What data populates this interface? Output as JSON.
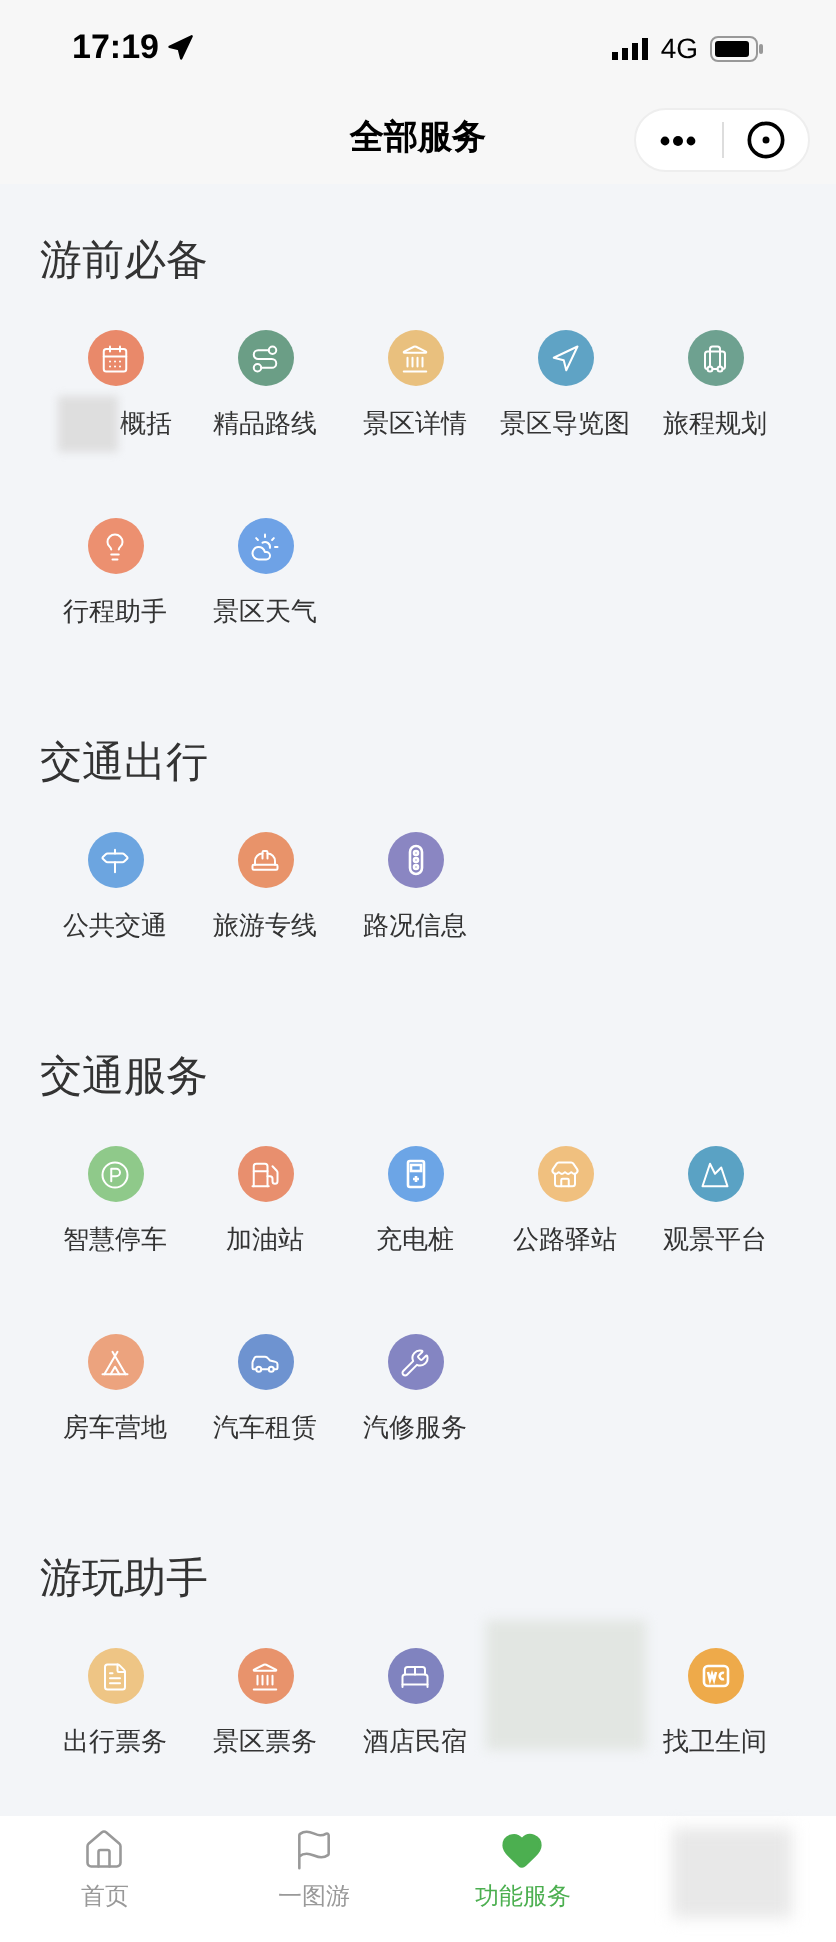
{
  "status_bar": {
    "time": "17:19",
    "network": "4G"
  },
  "nav": {
    "title": "全部服务"
  },
  "sections": [
    {
      "title": "游前必备",
      "items": [
        {
          "kind": "masked_label",
          "label": "概括",
          "color": "#e9896a"
        },
        {
          "kind": "service",
          "label": "精品路线",
          "color": "#6b9e86"
        },
        {
          "kind": "service",
          "label": "景区详情",
          "color": "#e9c07e"
        },
        {
          "kind": "service",
          "label": "景区导览图",
          "color": "#5fa3c5"
        },
        {
          "kind": "service",
          "label": "旅程规划",
          "color": "#6ea190"
        },
        {
          "kind": "service",
          "label": "行程助手",
          "color": "#ec9070"
        },
        {
          "kind": "service",
          "label": "景区天气",
          "color": "#6ea2e6"
        }
      ]
    },
    {
      "title": "交通出行",
      "items": [
        {
          "kind": "service",
          "label": "公共交通",
          "color": "#6ca5e0"
        },
        {
          "kind": "service",
          "label": "旅游专线",
          "color": "#e8936a"
        },
        {
          "kind": "service",
          "label": "路况信息",
          "color": "#8a86c2"
        }
      ]
    },
    {
      "title": "交通服务",
      "items": [
        {
          "kind": "service",
          "label": "智慧停车",
          "color": "#8fc98a"
        },
        {
          "kind": "service",
          "label": "加油站",
          "color": "#e88f6e"
        },
        {
          "kind": "service",
          "label": "充电桩",
          "color": "#6ca5e6"
        },
        {
          "kind": "service",
          "label": "公路驿站",
          "color": "#f0c07f"
        },
        {
          "kind": "service",
          "label": "观景平台",
          "color": "#5aa2c4"
        },
        {
          "kind": "service",
          "label": "房车营地",
          "color": "#eca37e"
        },
        {
          "kind": "service",
          "label": "汽车租赁",
          "color": "#6e93d0"
        },
        {
          "kind": "service",
          "label": "汽修服务",
          "color": "#8485c2"
        }
      ]
    },
    {
      "title": "游玩助手",
      "items": [
        {
          "kind": "service",
          "label": "出行票务",
          "color": "#eec585"
        },
        {
          "kind": "service",
          "label": "景区票务",
          "color": "#e8936c"
        },
        {
          "kind": "service",
          "label": "酒店民宿",
          "color": "#8083bf"
        },
        {
          "kind": "redacted"
        },
        {
          "kind": "service",
          "label": "找卫生间",
          "color": "#eeaa4a"
        }
      ]
    }
  ],
  "tab_bar": [
    {
      "kind": "tab",
      "label": "首页",
      "selected": false
    },
    {
      "kind": "tab",
      "label": "一图游",
      "selected": false
    },
    {
      "kind": "tab",
      "label": "功能服务",
      "selected": true
    },
    {
      "kind": "redacted"
    }
  ]
}
